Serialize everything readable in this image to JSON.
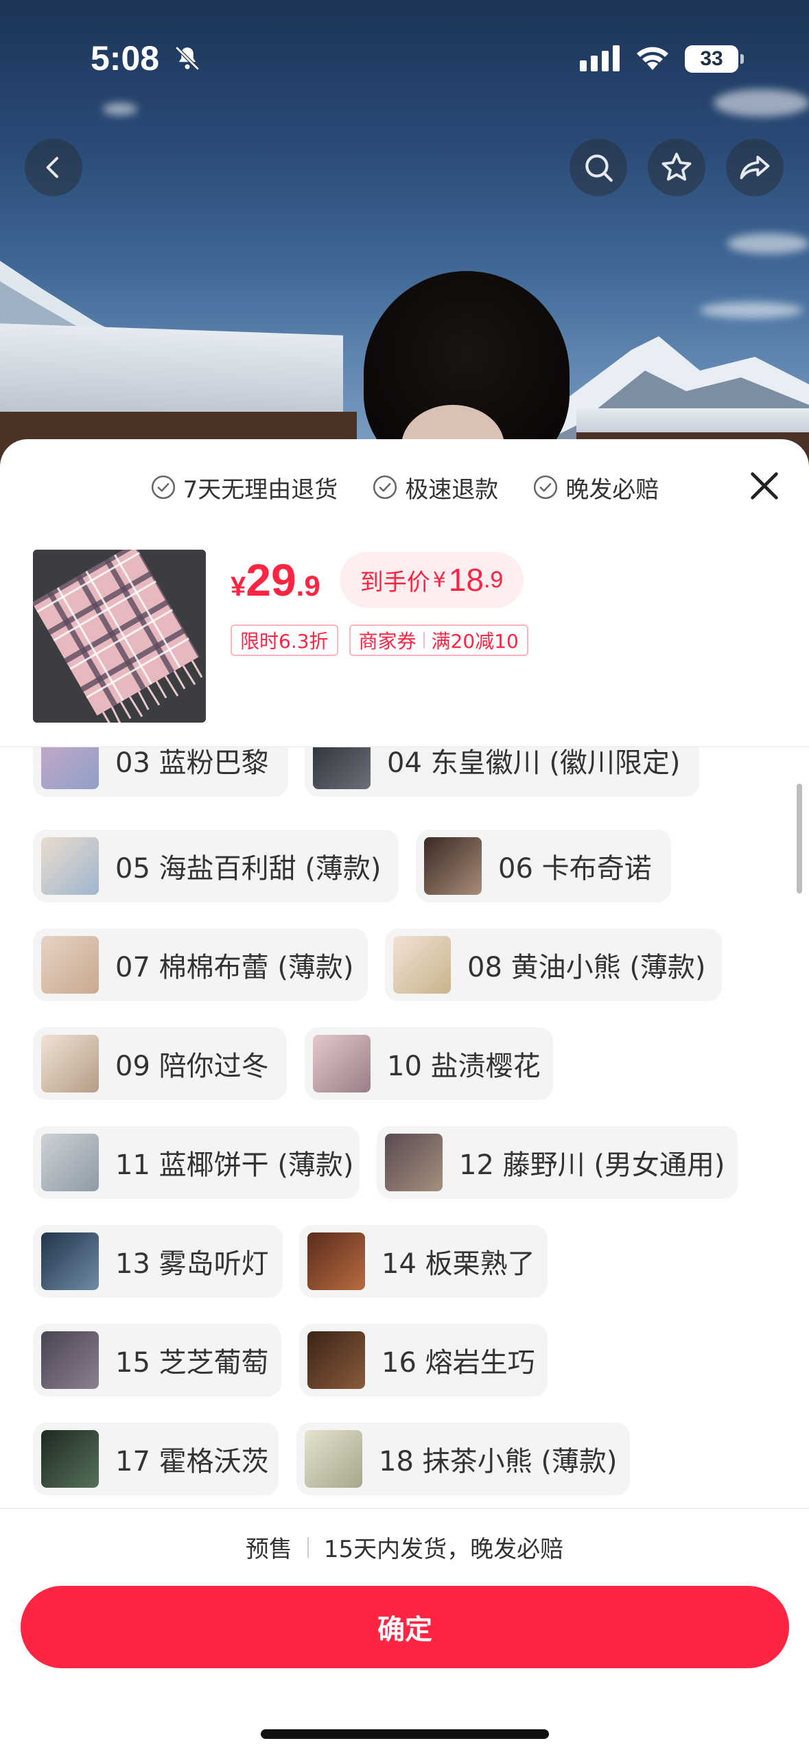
{
  "status_bar": {
    "time": "5:08",
    "battery": "33"
  },
  "guarantees": [
    {
      "label": "7天无理由退货",
      "icon": "check-circle-icon"
    },
    {
      "label": "极速退款",
      "icon": "check-circle-icon"
    },
    {
      "label": "晚发必赔",
      "icon": "check-circle-icon"
    }
  ],
  "product": {
    "currency": "¥",
    "price_int": "29",
    "price_dec": ".9",
    "final_price_label": "到手价",
    "final_currency": "¥",
    "final_price_int": "18",
    "final_price_dec": ".9",
    "discount_tag": "限时6.3折",
    "coupon_tag_a": "商家券",
    "coupon_tag_b": "满20减10"
  },
  "options": [
    {
      "label": "03 蓝粉巴黎"
    },
    {
      "label": "04 东皇徽川 (徽川限定)"
    },
    {
      "label": "05 海盐百利甜 (薄款)"
    },
    {
      "label": "06 卡布奇诺"
    },
    {
      "label": "07 棉棉布蕾 (薄款)"
    },
    {
      "label": "08 黄油小熊 (薄款)"
    },
    {
      "label": "09 陪你过冬"
    },
    {
      "label": "10 盐渍樱花"
    },
    {
      "label": "11 蓝椰饼干 (薄款)"
    },
    {
      "label": "12 藤野川 (男女通用)"
    },
    {
      "label": "13 雾岛听灯"
    },
    {
      "label": "14 板栗熟了"
    },
    {
      "label": "15 芝芝葡萄"
    },
    {
      "label": "16 熔岩生巧"
    },
    {
      "label": "17 霍格沃茨"
    },
    {
      "label": "18 抹茶小熊 (薄款)"
    },
    {
      "label": ""
    }
  ],
  "footer": {
    "presale": "预售",
    "shipping": "15天内发货，晚发必赔",
    "confirm": "确定"
  },
  "colors": {
    "accent": "#ff2442",
    "chip_bg": "#f4f4f4"
  }
}
